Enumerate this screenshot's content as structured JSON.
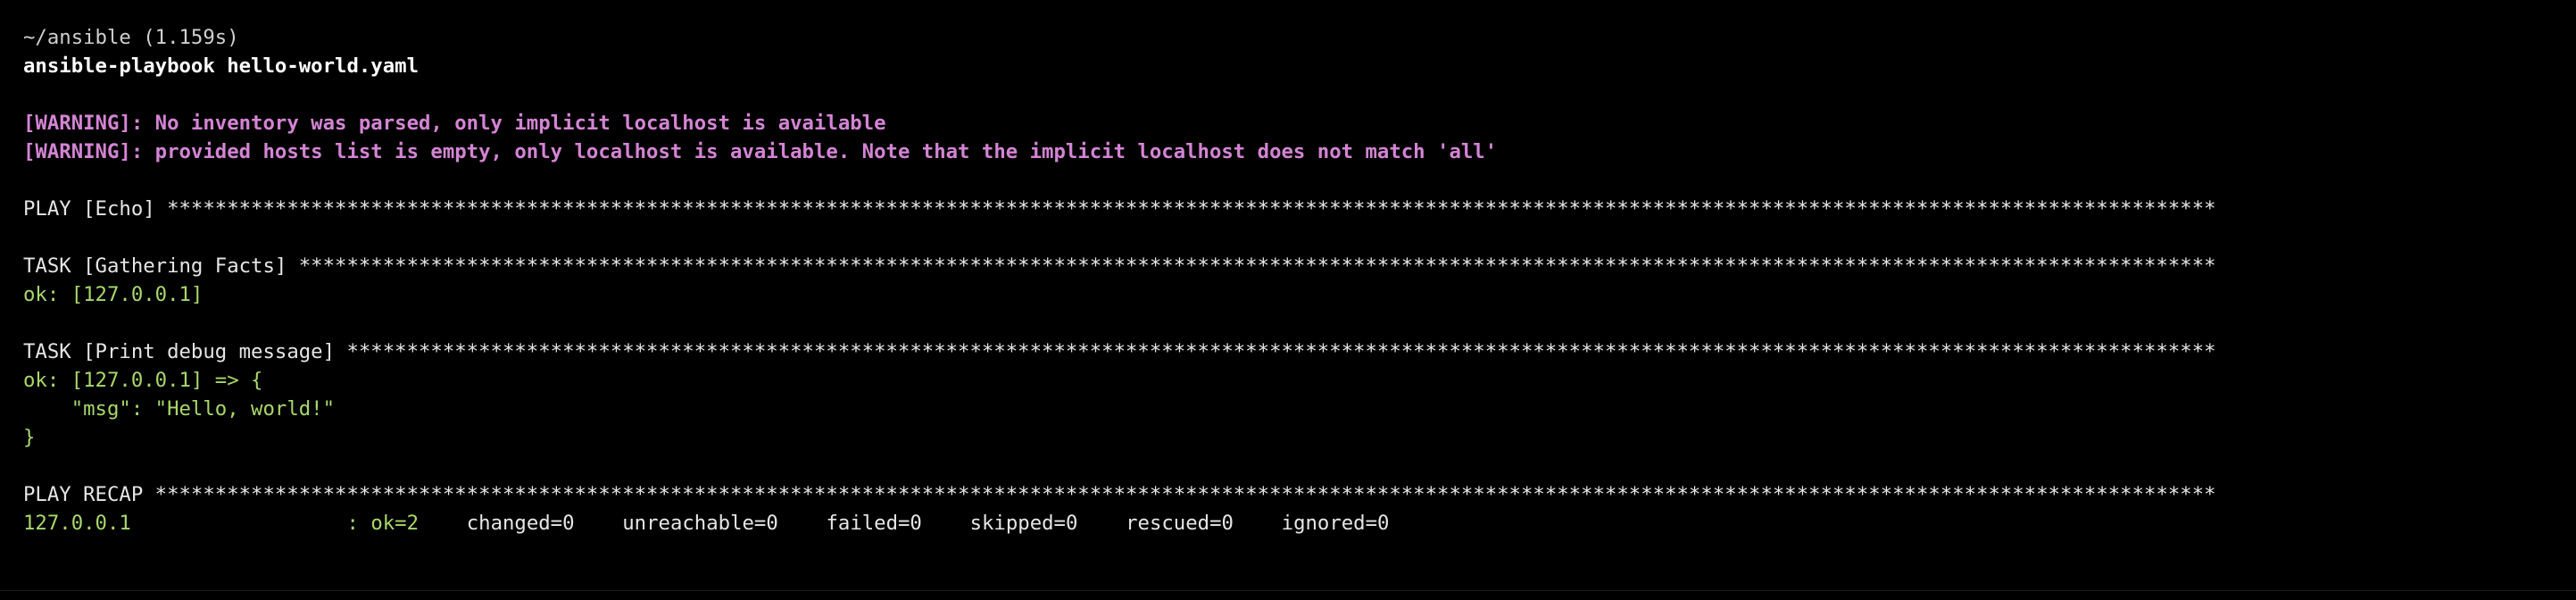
{
  "block": {
    "location": "~/ansible (1.159s)",
    "command": "ansible-playbook hello-world.yaml"
  },
  "warnings": [
    "[WARNING]: No inventory was parsed, only implicit localhost is available",
    "[WARNING]: provided hosts list is empty, only localhost is available. Note that the implicit localhost does not match 'all'"
  ],
  "play_header": "PLAY [Echo] ***************************************************************************************************************************************************************************",
  "task_facts": {
    "header": "TASK [Gathering Facts] ****************************************************************************************************************************************************************",
    "result": "ok: [127.0.0.1]"
  },
  "task_debug": {
    "header": "TASK [Print debug message] ************************************************************************************************************************************************************",
    "result_open": "ok: [127.0.0.1] => {",
    "msg_line": "    \"msg\": \"Hello, world!\"",
    "result_close": "}"
  },
  "recap": {
    "header": "PLAY RECAP ****************************************************************************************************************************************************************************",
    "host": "127.0.0.1",
    "separator": "                  : ",
    "ok": "ok=2",
    "changed": "changed=0",
    "unreachable": "unreachable=0",
    "failed": "failed=0",
    "skipped": "skipped=0",
    "rescued": "rescued=0",
    "ignored": "ignored=0",
    "gap": "    "
  },
  "colors": {
    "background": "#000000",
    "warning": "#d484d4",
    "ok": "#a8d86a",
    "text": "#e6e6e6"
  }
}
